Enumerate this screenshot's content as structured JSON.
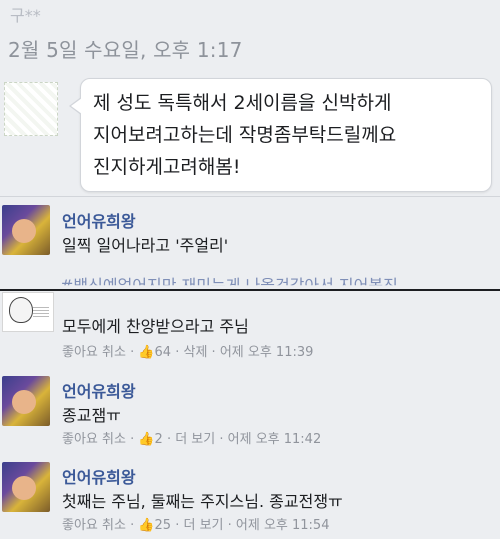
{
  "thread": {
    "sender_name": "구**",
    "timestamp": "2월 5일 수요일, 오후 1:17"
  },
  "message": {
    "lines": [
      "제 성도 독특해서 2세이름을 신박하게",
      "지어보려고하는데 작명좀부탁드릴께요",
      "진지하게고려해봄!"
    ]
  },
  "comments": [
    {
      "author": "언어유희왕",
      "text": "일찍 일어나라고 '주얼리'"
    },
    {
      "cut_text": "#뱀신예없어지만 재미는게 나올것같아서 지어봅진"
    },
    {
      "text": "모두에게 찬양받으라고 주님",
      "meta": {
        "like": "좋아요 취소",
        "like_count": "64",
        "action": "삭제",
        "time": "어제 오후 11:39"
      }
    },
    {
      "author": "언어유희왕",
      "text": "종교잼ㅠ",
      "meta": {
        "like": "좋아요 취소",
        "like_count": "2",
        "action": "더 보기",
        "time": "어제 오후 11:42"
      }
    },
    {
      "author": "언어유희왕",
      "text": "첫째는 주님, 둘째는 주지스님. 종교전쟁ㅠ",
      "meta": {
        "like": "좋아요 취소",
        "like_count": "25",
        "action": "더 보기",
        "time": "어제 오후 11:54"
      }
    }
  ],
  "separators": {
    "dot": " · ",
    "thumb": "👍"
  }
}
